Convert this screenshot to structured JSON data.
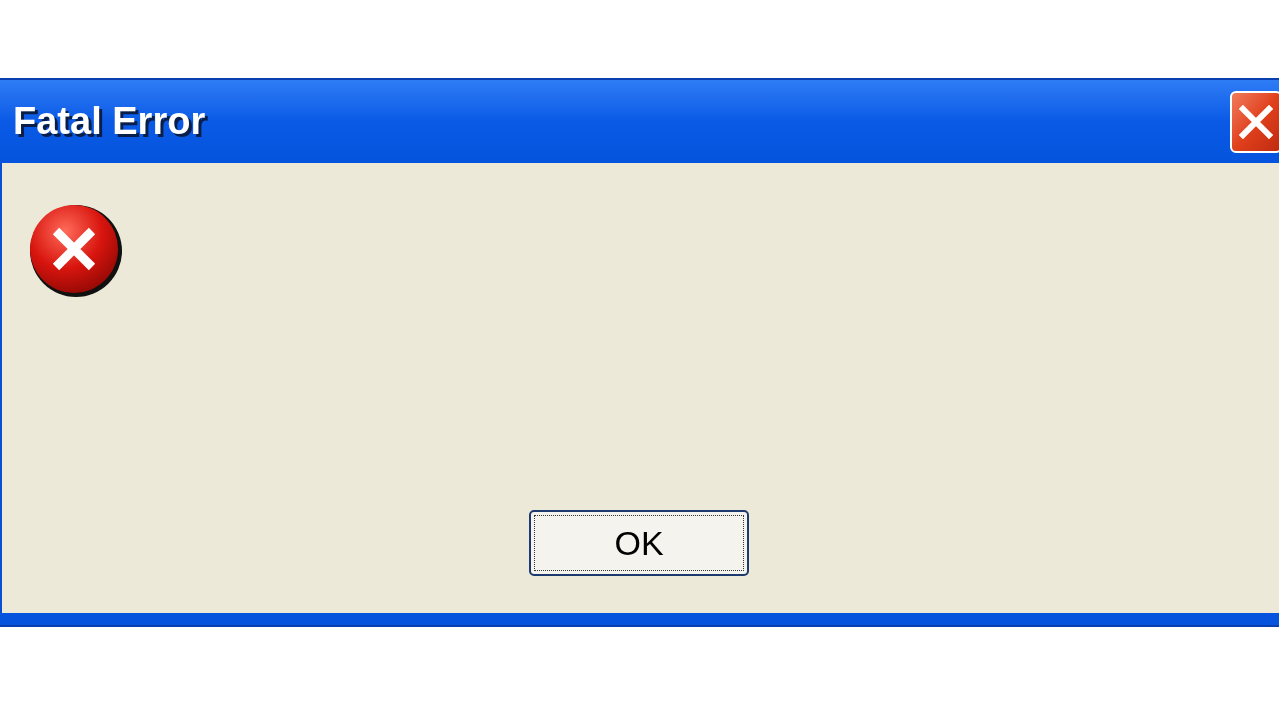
{
  "window": {
    "title": "Fatal Error"
  },
  "buttons": [
    {
      "label": "OK",
      "focused": true
    }
  ]
}
